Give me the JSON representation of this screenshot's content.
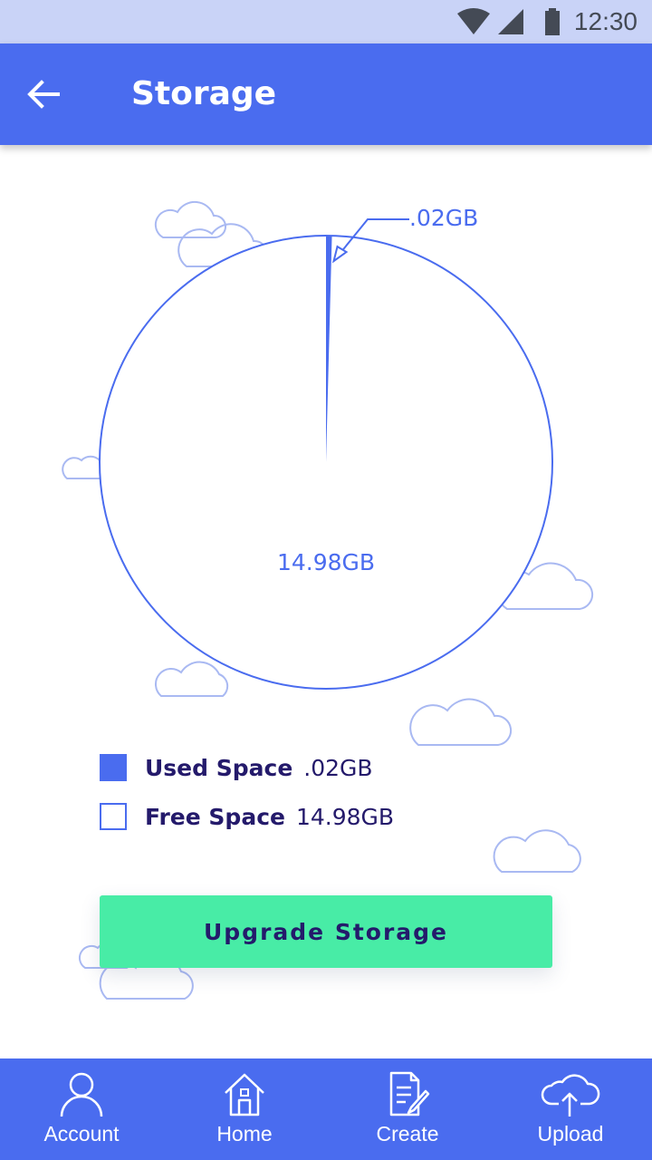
{
  "status_bar": {
    "time": "12:30"
  },
  "app_bar": {
    "title": "Storage"
  },
  "chart_data": {
    "type": "pie",
    "categories": [
      "Used Space",
      "Free Space"
    ],
    "values": [
      0.02,
      14.98
    ],
    "unit": "GB",
    "labels": [
      ".02GB",
      "14.98GB"
    ],
    "colors": [
      "#4a6cef",
      "#ffffff"
    ]
  },
  "legend": {
    "items": [
      {
        "label": "Used Space",
        "value": ".02GB",
        "swatch": "filled"
      },
      {
        "label": "Free Space",
        "value": "14.98GB",
        "swatch": "outline"
      }
    ]
  },
  "upgrade_button": {
    "label": "Upgrade Storage"
  },
  "bottom_nav": {
    "items": [
      {
        "label": "Account",
        "icon": "account-icon"
      },
      {
        "label": "Home",
        "icon": "home-icon"
      },
      {
        "label": "Create",
        "icon": "create-icon"
      },
      {
        "label": "Upload",
        "icon": "upload-icon"
      }
    ]
  },
  "colors": {
    "primary": "#4a6cef",
    "accent": "#48eca6",
    "text_dark": "#241a6b",
    "status_bar": "#c9d3f7"
  }
}
